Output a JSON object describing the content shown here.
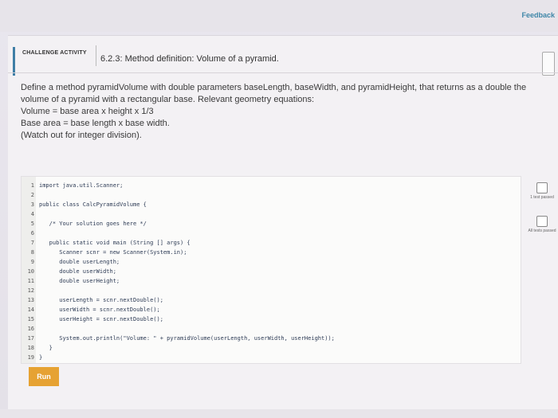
{
  "topbar": {
    "feedback_label": "Feedback"
  },
  "activity": {
    "badge": "CHALLENGE ACTIVITY",
    "title": "6.2.3: Method definition: Volume of a pyramid."
  },
  "description": [
    "Define a method pyramidVolume with double parameters baseLength, baseWidth, and pyramidHeight, that returns as a double the",
    "volume of a pyramid with a rectangular base. Relevant geometry equations:",
    "Volume = base area x height x 1/3",
    "Base area = base length x base width.",
    "(Watch out for integer division)."
  ],
  "code": [
    {
      "n": "1",
      "t": "import java.util.Scanner;"
    },
    {
      "n": "2",
      "t": ""
    },
    {
      "n": "3",
      "t": "public class CalcPyramidVolume {"
    },
    {
      "n": "4",
      "t": ""
    },
    {
      "n": "5",
      "t": "   /* Your solution goes here */"
    },
    {
      "n": "6",
      "t": ""
    },
    {
      "n": "7",
      "t": "   public static void main (String [] args) {"
    },
    {
      "n": "8",
      "t": "      Scanner scnr = new Scanner(System.in);"
    },
    {
      "n": "9",
      "t": "      double userLength;"
    },
    {
      "n": "10",
      "t": "      double userWidth;"
    },
    {
      "n": "11",
      "t": "      double userHeight;"
    },
    {
      "n": "12",
      "t": ""
    },
    {
      "n": "13",
      "t": "      userLength = scnr.nextDouble();"
    },
    {
      "n": "14",
      "t": "      userWidth = scnr.nextDouble();"
    },
    {
      "n": "15",
      "t": "      userHeight = scnr.nextDouble();"
    },
    {
      "n": "16",
      "t": ""
    },
    {
      "n": "17",
      "t": "      System.out.println(\"Volume: \" + pyramidVolume(userLength, userWidth, userHeight));"
    },
    {
      "n": "18",
      "t": "   }"
    },
    {
      "n": "19",
      "t": "}"
    }
  ],
  "tests": [
    {
      "label": "1 test passed"
    },
    {
      "label": "All tests passed"
    }
  ],
  "run_label": "Run"
}
